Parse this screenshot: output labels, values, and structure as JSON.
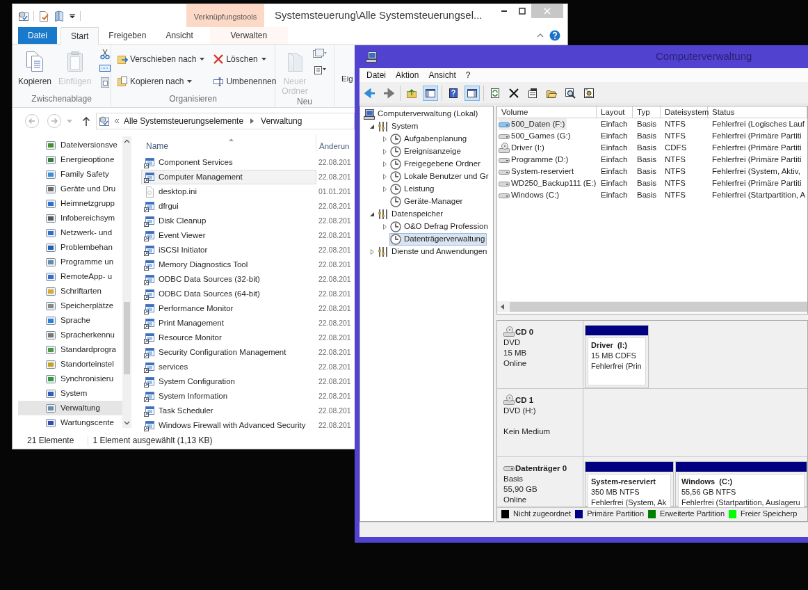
{
  "explorer": {
    "title": "Systemsteuerung\\Alle Systemsteuerungsel...",
    "context_group": "Verknüpfungstools",
    "tabs": [
      {
        "label": "Datei",
        "kind": "file",
        "selected": false
      },
      {
        "label": "Start",
        "kind": "tab",
        "selected": true
      },
      {
        "label": "Freigeben",
        "kind": "tab",
        "selected": false
      },
      {
        "label": "Ansicht",
        "kind": "tab",
        "selected": false
      },
      {
        "label": "Verwalten",
        "kind": "context",
        "selected": false
      }
    ],
    "ribbon": [
      {
        "label": "Zwischenablage",
        "commands": [
          {
            "label": "Kopieren",
            "kind": "large",
            "disabled": false
          },
          {
            "label": "Einfügen",
            "kind": "large",
            "disabled": true
          }
        ]
      },
      {
        "label": "Organisieren",
        "commands": [
          {
            "label": "Verschieben nach",
            "kind": "menu",
            "disabled": false
          },
          {
            "label": "Kopieren nach",
            "kind": "menu",
            "disabled": false
          },
          {
            "label": "Löschen",
            "kind": "menu",
            "disabled": false
          },
          {
            "label": "Umbenennen",
            "kind": "small",
            "disabled": false
          }
        ]
      },
      {
        "label": "Neu",
        "commands": [
          {
            "label": "Neuer Ordner",
            "kind": "large",
            "disabled": true
          }
        ]
      },
      {
        "commands": [
          {
            "label": "Eig",
            "kind": "large",
            "disabled": false
          }
        ]
      }
    ],
    "address": [
      "Alle Systemsteuerungselemente",
      "Verwaltung"
    ],
    "nav_items": [
      {
        "label": "Dateiversionsve",
        "selected": false
      },
      {
        "label": "Energieoptione",
        "selected": false
      },
      {
        "label": "Family Safety",
        "selected": false
      },
      {
        "label": "Geräte und Dru",
        "selected": false
      },
      {
        "label": "Heimnetzgrupp",
        "selected": false
      },
      {
        "label": "Infobereichsym",
        "selected": false
      },
      {
        "label": "Netzwerk- und",
        "selected": false
      },
      {
        "label": "Problembehan",
        "selected": false
      },
      {
        "label": "Programme un",
        "selected": false
      },
      {
        "label": "RemoteApp- u",
        "selected": false
      },
      {
        "label": "Schriftarten",
        "selected": false
      },
      {
        "label": "Speicherplätze",
        "selected": false
      },
      {
        "label": "Sprache",
        "selected": false
      },
      {
        "label": "Spracherkennu",
        "selected": false
      },
      {
        "label": "Standardprogra",
        "selected": false
      },
      {
        "label": "Standorteinstel",
        "selected": false
      },
      {
        "label": "Synchronisieru",
        "selected": false
      },
      {
        "label": "System",
        "selected": false
      },
      {
        "label": "Verwaltung",
        "selected": true
      },
      {
        "label": "Wartungscente",
        "selected": false
      }
    ],
    "columns": [
      "Name",
      "Änderun"
    ],
    "files": [
      {
        "name": "Component Services",
        "date": "22.08.201",
        "kind": "shortcut",
        "selected": false
      },
      {
        "name": "Computer Management",
        "date": "22.08.201",
        "kind": "shortcut",
        "selected": true
      },
      {
        "name": "desktop.ini",
        "date": "01.01.201",
        "kind": "file",
        "selected": false
      },
      {
        "name": "dfrgui",
        "date": "22.08.201",
        "kind": "shortcut",
        "selected": false
      },
      {
        "name": "Disk Cleanup",
        "date": "22.08.201",
        "kind": "shortcut",
        "selected": false
      },
      {
        "name": "Event Viewer",
        "date": "22.08.201",
        "kind": "shortcut",
        "selected": false
      },
      {
        "name": "iSCSI Initiator",
        "date": "22.08.201",
        "kind": "shortcut",
        "selected": false
      },
      {
        "name": "Memory Diagnostics Tool",
        "date": "22.08.201",
        "kind": "shortcut",
        "selected": false
      },
      {
        "name": "ODBC Data Sources (32-bit)",
        "date": "22.08.201",
        "kind": "shortcut",
        "selected": false
      },
      {
        "name": "ODBC Data Sources (64-bit)",
        "date": "22.08.201",
        "kind": "shortcut",
        "selected": false
      },
      {
        "name": "Performance Monitor",
        "date": "22.08.201",
        "kind": "shortcut",
        "selected": false
      },
      {
        "name": "Print Management",
        "date": "22.08.201",
        "kind": "shortcut",
        "selected": false
      },
      {
        "name": "Resource Monitor",
        "date": "22.08.201",
        "kind": "shortcut",
        "selected": false
      },
      {
        "name": "Security Configuration Management",
        "date": "22.08.201",
        "kind": "shortcut",
        "selected": false
      },
      {
        "name": "services",
        "date": "22.08.201",
        "kind": "shortcut",
        "selected": false
      },
      {
        "name": "System Configuration",
        "date": "22.08.201",
        "kind": "shortcut",
        "selected": false
      },
      {
        "name": "System Information",
        "date": "22.08.201",
        "kind": "shortcut",
        "selected": false
      },
      {
        "name": "Task Scheduler",
        "date": "22.08.201",
        "kind": "shortcut",
        "selected": false
      },
      {
        "name": "Windows Firewall with Advanced Security",
        "date": "22.08.201",
        "kind": "shortcut",
        "selected": false
      }
    ],
    "status": [
      "21 Elemente",
      "1 Element ausgewählt (1,13 KB)"
    ]
  },
  "computer_management": {
    "title": "Computerverwaltung",
    "menu": [
      "Datei",
      "Aktion",
      "Ansicht",
      "?"
    ],
    "tree": [
      {
        "label": "Computerverwaltung (Lokal)",
        "selected": false,
        "children": [
          {
            "label": "System",
            "expanded": true,
            "selected": false,
            "children": [
              {
                "label": "Aufgabenplanung",
                "expanded": false,
                "selected": false
              },
              {
                "label": "Ereignisanzeige",
                "expanded": false,
                "selected": false
              },
              {
                "label": "Freigegebene Ordner",
                "expanded": false,
                "selected": false
              },
              {
                "label": "Lokale Benutzer und Gr",
                "expanded": false,
                "selected": false
              },
              {
                "label": "Leistung",
                "expanded": false,
                "selected": false
              },
              {
                "label": "Geräte-Manager",
                "selected": false
              }
            ]
          },
          {
            "label": "Datenspeicher",
            "expanded": true,
            "selected": false,
            "children": [
              {
                "label": "O&O Defrag Profession",
                "expanded": false,
                "selected": false
              },
              {
                "label": "Datenträgerverwaltung",
                "selected": true
              }
            ]
          },
          {
            "label": "Dienste und Anwendungen",
            "expanded": false,
            "selected": false
          }
        ]
      }
    ],
    "columns": [
      "Volume",
      "Layout",
      "Typ",
      "Dateisystem",
      "Status"
    ],
    "volumes": [
      {
        "kind": "disk",
        "selected": true,
        "cells": [
          "500_Daten (F:)",
          "Einfach",
          "Basis",
          "NTFS",
          "Fehlerfrei (Logisches Lauf"
        ]
      },
      {
        "kind": "disk",
        "selected": false,
        "cells": [
          "500_Games (G:)",
          "Einfach",
          "Basis",
          "NTFS",
          "Fehlerfrei (Primäre Partiti"
        ]
      },
      {
        "kind": "cd",
        "selected": false,
        "cells": [
          "Driver (I:)",
          "Einfach",
          "Basis",
          "CDFS",
          "Fehlerfrei (Primäre Partiti"
        ]
      },
      {
        "kind": "disk",
        "selected": false,
        "cells": [
          "Programme (D:)",
          "Einfach",
          "Basis",
          "NTFS",
          "Fehlerfrei (Primäre Partiti"
        ]
      },
      {
        "kind": "disk",
        "selected": false,
        "cells": [
          "System-reserviert",
          "Einfach",
          "Basis",
          "NTFS",
          "Fehlerfrei (System, Aktiv,"
        ]
      },
      {
        "kind": "disk",
        "selected": false,
        "cells": [
          "WD250_Backup111 (E:)",
          "Einfach",
          "Basis",
          "NTFS",
          "Fehlerfrei (Primäre Partiti"
        ]
      },
      {
        "kind": "disk",
        "selected": false,
        "cells": [
          "Windows (C:)",
          "Einfach",
          "Basis",
          "NTFS",
          "Fehlerfrei (Startpartition, A"
        ]
      }
    ],
    "disks": [
      {
        "name": "CD 0",
        "kind": "cd",
        "type": "DVD",
        "size": "15 MB",
        "status": "Online",
        "partitions": [
          {
            "name": "Driver  (I:)",
            "size": "15 MB CDFS",
            "status": "Fehlerfrei (Prin",
            "color": "#000080"
          }
        ]
      },
      {
        "name": "CD 1",
        "kind": "cd",
        "type": "DVD (H:)",
        "status": "Kein Medium"
      },
      {
        "name": "Datenträger 0",
        "kind": "disk",
        "type": "Basis",
        "size": "55,90 GB",
        "status": "Online",
        "partitions": [
          {
            "name": "System-reserviert",
            "size": "350 MB NTFS",
            "status": "Fehlerfrei (System, Ak",
            "color": "#000080"
          },
          {
            "name": "Windows  (C:)",
            "size": "55,56 GB NTFS",
            "status": "Fehlerfrei (Startpartition, Auslageru",
            "color": "#000080"
          }
        ]
      }
    ],
    "legend": [
      {
        "label": "Nicht zugeordnet",
        "color": "#000000"
      },
      {
        "label": "Primäre Partition",
        "color": "#000080"
      },
      {
        "label": "Erweiterte Partition",
        "color": "#008000"
      },
      {
        "label": "Freier Speicherp",
        "color": "#00ff00"
      }
    ]
  }
}
